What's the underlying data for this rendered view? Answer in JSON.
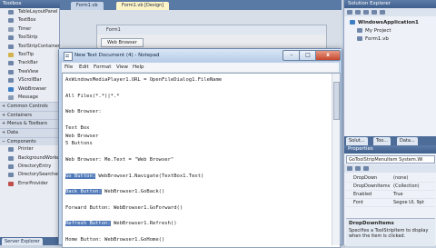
{
  "toolbox": {
    "title": "Toolbox",
    "items": [
      {
        "label": "TableLayoutPanel",
        "color": "#6f86a9"
      },
      {
        "label": "TextBox",
        "color": "#6f86a9"
      },
      {
        "label": "Timer",
        "color": "#8a9bb5"
      },
      {
        "label": "ToolStrip",
        "color": "#6f86a9"
      },
      {
        "label": "ToolStripContainer",
        "color": "#6f86a9"
      },
      {
        "label": "ToolTip",
        "color": "#d4b24c"
      },
      {
        "label": "TrackBar",
        "color": "#6f86a9"
      },
      {
        "label": "TreeView",
        "color": "#6f86a9"
      },
      {
        "label": "VScrollBar",
        "color": "#6f86a9"
      },
      {
        "label": "WebBrowser",
        "color": "#3d7fc4"
      },
      {
        "label": "Message",
        "color": "#8a9bb5"
      }
    ],
    "categories": [
      {
        "label": "Common Controls",
        "open": false
      },
      {
        "label": "Containers",
        "open": false
      },
      {
        "label": "Menus & Toolbars",
        "open": false
      },
      {
        "label": "Data",
        "open": false
      },
      {
        "label": "Components",
        "open": true
      }
    ],
    "component_items": [
      {
        "label": "Printer",
        "color": "#6f86a9"
      },
      {
        "label": "BackgroundWorker",
        "color": "#6f86a9"
      },
      {
        "label": "DirectoryEntry",
        "color": "#6f86a9"
      },
      {
        "label": "DirectorySearcher",
        "color": "#6f86a9"
      },
      {
        "label": "ErrorProvider",
        "color": "#c0504d"
      }
    ],
    "footer_tab": "Server Explorer"
  },
  "designer": {
    "tabs": [
      "Form1.vb",
      "Form1.vb [Design]"
    ],
    "form_title": "Form1",
    "form_menu_item": "Web Browser"
  },
  "notepad": {
    "title": "New Text Document (4) - Notepad",
    "menu": [
      "File",
      "Edit",
      "Format",
      "View",
      "Help"
    ],
    "buttons": {
      "minimize": "–",
      "maximize": "□",
      "close": "x"
    },
    "lines": [
      {
        "text": "AxWindowsMediaPlayer1.URL = OpenFileDialog1.FileName",
        "selected": false
      },
      {
        "text": "",
        "selected": false
      },
      {
        "text": "All Files(*.*)|*.*",
        "selected": false
      },
      {
        "text": "",
        "selected": false
      },
      {
        "text": "Web Browser:",
        "selected": false
      },
      {
        "text": "",
        "selected": false
      },
      {
        "text": "Text Box",
        "selected": false
      },
      {
        "text": "Web Browser",
        "selected": false
      },
      {
        "text": "5 Buttons",
        "selected": false
      },
      {
        "text": "",
        "selected": false
      },
      {
        "text": "Web Browser: Me.Text = \"Web Browser\"",
        "selected": false
      },
      {
        "text": "",
        "selected": false
      },
      {
        "text": "Go Button:",
        "selected": true,
        "rest": " WebBrowser1.Navigate(TextBox1.Text)"
      },
      {
        "text": "",
        "selected": false
      },
      {
        "text": "Back Button:",
        "selected": true,
        "rest": " WebBrowser1.GoBack()"
      },
      {
        "text": "",
        "selected": false
      },
      {
        "text": "Forward Button:",
        "selected": false,
        "rest": " WebBrowser1.GoForward()"
      },
      {
        "text": "",
        "selected": false
      },
      {
        "text": "Refresh Button:",
        "selected": true,
        "rest": " WebBrowser1.Refresh()"
      },
      {
        "text": "",
        "selected": false
      },
      {
        "text": "Home Button:",
        "selected": false,
        "rest": " WebBrowser1.GoHome()"
      }
    ]
  },
  "solution_explorer": {
    "title": "Solution Explorer",
    "tree": [
      {
        "label": "WindowsApplication1",
        "bold": true,
        "indent": 0,
        "color": "#3d7fc4"
      },
      {
        "label": "My Project",
        "bold": false,
        "indent": 1,
        "color": "#6f86a9"
      },
      {
        "label": "Form1.vb",
        "bold": false,
        "indent": 1,
        "color": "#6f86a9"
      }
    ],
    "tabs": [
      "Solut...",
      "Too...",
      "Data..."
    ]
  },
  "properties": {
    "title": "Properties",
    "object": "GoToolStripMenuItem  System.Wi",
    "rows": [
      {
        "name": "DropDown",
        "value": "(none)"
      },
      {
        "name": "DropDownItems",
        "value": "(Collection)"
      },
      {
        "name": "Enabled",
        "value": "True"
      },
      {
        "name": "Font",
        "value": "Segoe UI, 9pt"
      }
    ],
    "desc_title": "DropDownItems",
    "desc_text": "Specifies a ToolStripItem to display when the item is clicked."
  }
}
